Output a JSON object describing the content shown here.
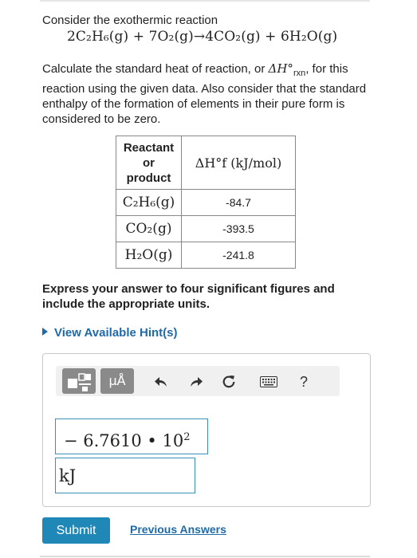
{
  "problem": {
    "intro": "Consider the exothermic reaction",
    "equation": "2C₂H₆(g) + 7O₂(g)→4CO₂(g) + 6H₂O(g)",
    "task_before": "Calculate the standard heat of reaction, or",
    "task_symbol": "ΔH°",
    "task_sub": "rxn",
    "task_after": ", for this reaction using the given data. Also consider that the standard enthalpy of the formation of elements in their pure form is considered to be zero."
  },
  "table": {
    "header_col1_line1": "Reactant",
    "header_col1_line2": "or",
    "header_col1_line3": "product",
    "header_col2": "ΔH°f (kJ/mol)",
    "rows": [
      {
        "species": "C₂H₆(g)",
        "value": "-84.7"
      },
      {
        "species": "CO₂(g)",
        "value": "-393.5"
      },
      {
        "species": "H₂O(g)",
        "value": "-241.8"
      }
    ]
  },
  "instructions": "Express your answer to four significant figures and include the appropriate units.",
  "hints_link": "View Available Hint(s)",
  "toolbar": {
    "units_label": "μÅ",
    "help_label": "?",
    "icons": [
      "templates-icon",
      "units-icon",
      "undo-icon",
      "redo-icon",
      "reset-icon",
      "keyboard-icon",
      "help-icon"
    ]
  },
  "answer": {
    "value_text": "− 6.7610 • 10",
    "exponent": "2",
    "units": "kJ"
  },
  "buttons": {
    "submit": "Submit",
    "previous_answers": "Previous Answers"
  },
  "colors": {
    "link": "#1f6aa8",
    "submit_bg": "#1f88b6",
    "field_border": "#3a90b8",
    "toolbar_button": "#8a8a8a"
  }
}
